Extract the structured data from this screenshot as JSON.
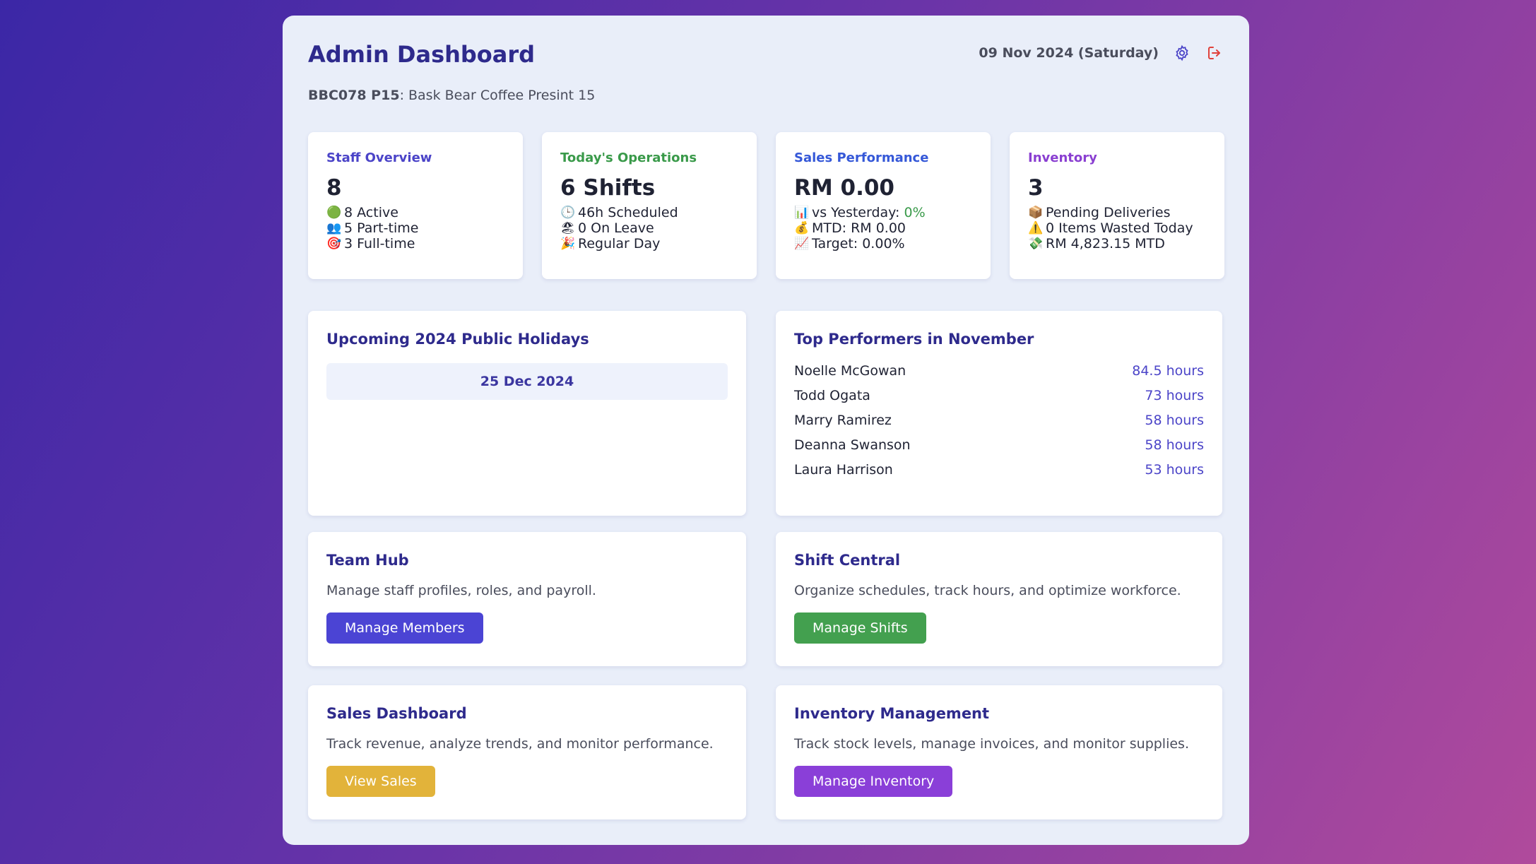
{
  "header": {
    "title": "Admin Dashboard",
    "date": "09 Nov 2024 (Saturday)",
    "settings_icon": "gear-icon",
    "logout_icon": "logout-icon"
  },
  "branch": {
    "code": "BBC078 P15",
    "name": ": Bask Bear Coffee Presint 15"
  },
  "stats": [
    {
      "label": "Staff Overview",
      "color": "#4b44c8",
      "value": "8",
      "lines": [
        {
          "emoji": "🟢",
          "text": "8 Active"
        },
        {
          "emoji": "👥",
          "text": "5 Part-time"
        },
        {
          "emoji": "🎯",
          "text": "3 Full-time"
        }
      ]
    },
    {
      "label": "Today's Operations",
      "color": "#3a9a4a",
      "value": "6 Shifts",
      "lines": [
        {
          "emoji": "🕒",
          "text": "46h Scheduled"
        },
        {
          "emoji": "🏖",
          "text": "0 On Leave"
        },
        {
          "emoji": "🎉",
          "text": "Regular Day"
        }
      ]
    },
    {
      "label": "Sales Performance",
      "color": "#3558d8",
      "value": "RM 0.00",
      "lines": [
        {
          "emoji": "📊",
          "text": "vs Yesterday: ",
          "accent": "0%"
        },
        {
          "emoji": "💰",
          "text": "MTD: RM 0.00"
        },
        {
          "emoji": "📈",
          "text": "Target: 0.00%"
        }
      ]
    },
    {
      "label": "Inventory",
      "color": "#8a3fd1",
      "value": "3",
      "lines": [
        {
          "emoji": "📦",
          "text": "Pending Deliveries"
        },
        {
          "emoji": "⚠️",
          "text": "0 Items Wasted Today"
        },
        {
          "emoji": "💸",
          "text": "RM 4,823.15 MTD"
        }
      ]
    }
  ],
  "holidays": {
    "title": "Upcoming 2024 Public Holidays",
    "items": [
      "25 Dec 2024"
    ]
  },
  "performers": {
    "title": "Top Performers in November",
    "rows": [
      {
        "name": "Noelle McGowan",
        "hours": "84.5 hours"
      },
      {
        "name": "Todd Ogata",
        "hours": "73 hours"
      },
      {
        "name": "Marry Ramirez",
        "hours": "58 hours"
      },
      {
        "name": "Deanna Swanson",
        "hours": "58 hours"
      },
      {
        "name": "Laura Harrison",
        "hours": "53 hours"
      }
    ]
  },
  "actions": [
    {
      "title": "Team Hub",
      "desc": "Manage staff profiles, roles, and payroll.",
      "button": "Manage Members",
      "color": "#4b44d4"
    },
    {
      "title": "Shift Central",
      "desc": "Organize schedules, track hours, and optimize workforce.",
      "button": "Manage Shifts",
      "color": "#43a04f"
    },
    {
      "title": "Sales Dashboard",
      "desc": "Track revenue, analyze trends, and monitor performance.",
      "button": "View Sales",
      "color": "#e2b33a"
    },
    {
      "title": "Inventory Management",
      "desc": "Track stock levels, manage invoices, and monitor supplies.",
      "button": "Manage Inventory",
      "color": "#8a3fd8"
    }
  ]
}
